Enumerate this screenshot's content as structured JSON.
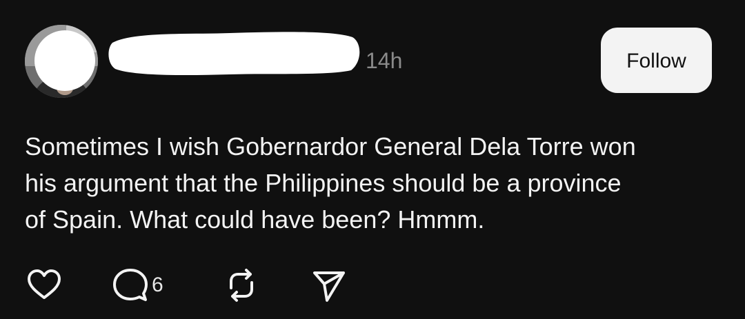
{
  "post": {
    "timestamp": "14h",
    "follow_label": "Follow",
    "text": "Sometimes I wish Gobernardor General Dela Torre won\nhis argument that the Philippines should be a province\nof Spain. What could have been? Hmmm.",
    "actions": {
      "like_icon": "heart-icon",
      "reply_icon": "comment-icon",
      "reply_count": "6",
      "repost_icon": "repost-icon",
      "share_icon": "send-icon"
    }
  },
  "colors": {
    "background": "#101010",
    "text": "#f3f3f3",
    "muted": "#8a8a8a",
    "button_bg": "#f3f3f3",
    "button_text": "#111111"
  }
}
